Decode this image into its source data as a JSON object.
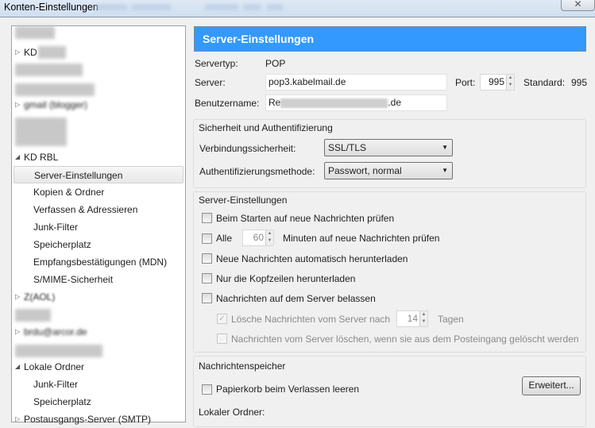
{
  "window": {
    "title": "Konten-Einstellungen",
    "close_glyph": "✕"
  },
  "tree": {
    "items": [
      {
        "label": "KD",
        "twisty": "▷"
      },
      {
        "label": "gmail (blogger)",
        "twisty": "▷"
      },
      {
        "label": "KD RBL",
        "twisty": "◢"
      },
      {
        "label": "Server-Einstellungen"
      },
      {
        "label": "Kopien & Ordner"
      },
      {
        "label": "Verfassen & Adressieren"
      },
      {
        "label": "Junk-Filter"
      },
      {
        "label": "Speicherplatz"
      },
      {
        "label": "Empfangsbestätigungen (MDN)"
      },
      {
        "label": "S/MIME-Sicherheit"
      },
      {
        "label": "Z(AOL)",
        "twisty": "▷"
      },
      {
        "label": "brdu@arcor.de",
        "twisty": "▷"
      },
      {
        "label": "Lokale Ordner",
        "twisty": "◢"
      },
      {
        "label": "Junk-Filter"
      },
      {
        "label": "Speicherplatz"
      },
      {
        "label": "Postausgangs-Server (SMTP)",
        "twisty": "▷"
      }
    ]
  },
  "main": {
    "header": "Server-Einstellungen",
    "servertype_label": "Servertyp:",
    "servertype": "POP",
    "server_label": "Server:",
    "server": "pop3.kabelmail.de",
    "port_label": "Port:",
    "port": "995",
    "standard_label": "Standard:",
    "standard": "995",
    "user_label": "Benutzername:",
    "user_prefix": "Re",
    "user_suffix": ".de",
    "security": {
      "legend": "Sicherheit und Authentifizierung",
      "conn_label": "Verbindungssicherheit:",
      "conn_value": "SSL/TLS",
      "auth_label": "Authentifizierungsmethode:",
      "auth_value": "Passwort, normal"
    },
    "server_settings": {
      "legend": "Server-Einstellungen",
      "check_start": "Beim Starten auf neue Nachrichten prüfen",
      "every": "Alle",
      "minutes": "60",
      "minutes_text": "Minuten auf neue Nachrichten prüfen",
      "auto_download": "Neue Nachrichten automatisch herunterladen",
      "headers_only": "Nur die Kopfzeilen herunterladen",
      "leave_on_server": "Nachrichten auf dem Server belassen",
      "delete_after": "Lösche Nachrichten vom Server nach",
      "days": "14",
      "days_text": "Tagen",
      "delete_when": "Nachrichten vom Server löschen, wenn sie aus dem Posteingang gelöscht werden"
    },
    "storage": {
      "legend": "Nachrichtenspeicher",
      "empty_trash": "Papierkorb beim Verlassen leeren",
      "advanced": "Erweitert...",
      "local_folder_label": "Lokaler Ordner:"
    }
  }
}
